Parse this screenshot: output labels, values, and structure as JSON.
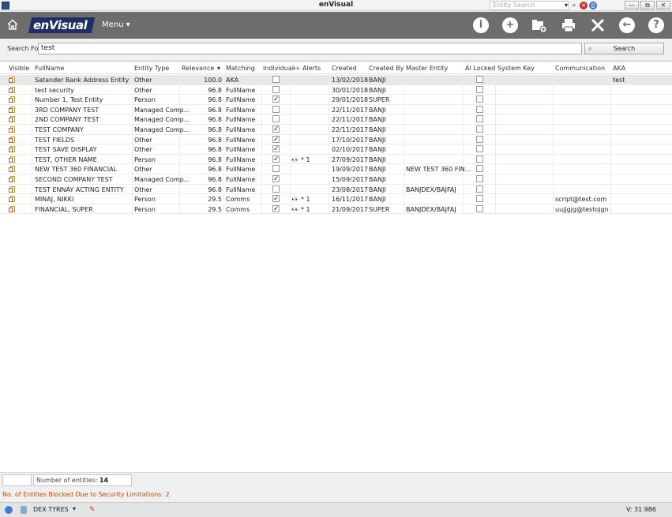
{
  "window": {
    "title": "enVisual",
    "entity_search_placeholder": "Entity Search",
    "min_label": "—",
    "restore_label": "⧉",
    "close_label": "✕"
  },
  "toolbar": {
    "logo_text": "enVisual",
    "menu_label": "Menu ▾"
  },
  "search": {
    "label": "Search For:",
    "value": "test",
    "button_label": "Search"
  },
  "grid": {
    "columns": [
      "Visible",
      "FullName",
      "Entity Type",
      "Relevance",
      "Matching",
      "Individual",
      "Alerts",
      "Created",
      "Created By",
      "Master Entity",
      "AI Locked",
      "System Key",
      "Communication",
      "AKA"
    ],
    "rows": [
      {
        "name": "Satander Bank Address Entity",
        "type": "Other",
        "relevance": "100.0",
        "matching": "AKA",
        "individual": false,
        "alerts": "",
        "created": "13/02/2018",
        "by": "BANJI",
        "master": "",
        "comm": "",
        "aka": "test"
      },
      {
        "name": "test security",
        "type": "Other",
        "relevance": "96.8",
        "matching": "FullName",
        "individual": false,
        "alerts": "",
        "created": "30/01/2018",
        "by": "BANJI",
        "master": "",
        "comm": "",
        "aka": ""
      },
      {
        "name": "Number 1, Test Entity",
        "type": "Person",
        "relevance": "96.8",
        "matching": "FullName",
        "individual": true,
        "alerts": "",
        "created": "29/01/2018",
        "by": "SUPER",
        "master": "",
        "comm": "",
        "aka": ""
      },
      {
        "name": "3RD COMPANY TEST",
        "type": "Managed Comp...",
        "relevance": "96.8",
        "matching": "FullName",
        "individual": false,
        "alerts": "",
        "created": "22/11/2017",
        "by": "BANJI",
        "master": "",
        "comm": "",
        "aka": ""
      },
      {
        "name": "2ND COMPANY TEST",
        "type": "Managed Comp...",
        "relevance": "96.8",
        "matching": "FullName",
        "individual": false,
        "alerts": "",
        "created": "22/11/2017",
        "by": "BANJI",
        "master": "",
        "comm": "",
        "aka": ""
      },
      {
        "name": "TEST COMPANY",
        "type": "Managed Comp...",
        "relevance": "96.8",
        "matching": "FullName",
        "individual": true,
        "alerts": "",
        "created": "22/11/2017",
        "by": "BANJI",
        "master": "",
        "comm": "",
        "aka": ""
      },
      {
        "name": "TEST FIELDS",
        "type": "Other",
        "relevance": "96.8",
        "matching": "FullName",
        "individual": true,
        "alerts": "",
        "created": "17/10/2017",
        "by": "BANJI",
        "master": "",
        "comm": "",
        "aka": ""
      },
      {
        "name": "TEST SAVE DISPLAY",
        "type": "Other",
        "relevance": "96.8",
        "matching": "FullName",
        "individual": true,
        "alerts": "",
        "created": "02/10/2017",
        "by": "BANJI",
        "master": "",
        "comm": "",
        "aka": ""
      },
      {
        "name": "TEST, OTHER NAME",
        "type": "Person",
        "relevance": "96.8",
        "matching": "FullName",
        "individual": true,
        "alerts": "* 1",
        "created": "27/09/2017",
        "by": "BANJI",
        "master": "",
        "comm": "",
        "aka": ""
      },
      {
        "name": "NEW TEST 360 FINANCIAL",
        "type": "Other",
        "relevance": "96.8",
        "matching": "FullName",
        "individual": false,
        "alerts": "",
        "created": "19/09/2017",
        "by": "BANJI",
        "master": "NEW TEST 360 FIN...",
        "comm": "",
        "aka": ""
      },
      {
        "name": "SECOND COMPANY TEST",
        "type": "Managed Comp...",
        "relevance": "96.8",
        "matching": "FullName",
        "individual": true,
        "alerts": "",
        "created": "15/09/2017",
        "by": "BANJI",
        "master": "",
        "comm": "",
        "aka": ""
      },
      {
        "name": "TEST ENNAY ACTING ENTITY",
        "type": "Other",
        "relevance": "96.8",
        "matching": "FullName",
        "individual": false,
        "alerts": "",
        "created": "23/08/2017",
        "by": "BANJI",
        "master": "BANJDEX/BAJFAJ",
        "comm": "",
        "aka": ""
      },
      {
        "name": "MINAJ, NIKKI",
        "type": "Person",
        "relevance": "29.5",
        "matching": "Comms",
        "individual": true,
        "alerts": "* 1",
        "created": "16/11/2017",
        "by": "BANJI",
        "master": "",
        "comm": "script@test.com",
        "aka": ""
      },
      {
        "name": "FINANCIAL, SUPER",
        "type": "Person",
        "relevance": "29.5",
        "matching": "Comms",
        "individual": true,
        "alerts": "* 1",
        "created": "21/09/2017",
        "by": "SUPER",
        "master": "BANJDEX/BAJFAJ",
        "comm": "uujjgjg@testojgn",
        "aka": ""
      }
    ]
  },
  "footer": {
    "count_label": "Number of entities:",
    "count_value": "14",
    "blocked_text": "No. of Entities Blocked Due to Security Limitations: 2"
  },
  "status": {
    "company": "DEX TYRES",
    "version": "V: 31.986"
  }
}
